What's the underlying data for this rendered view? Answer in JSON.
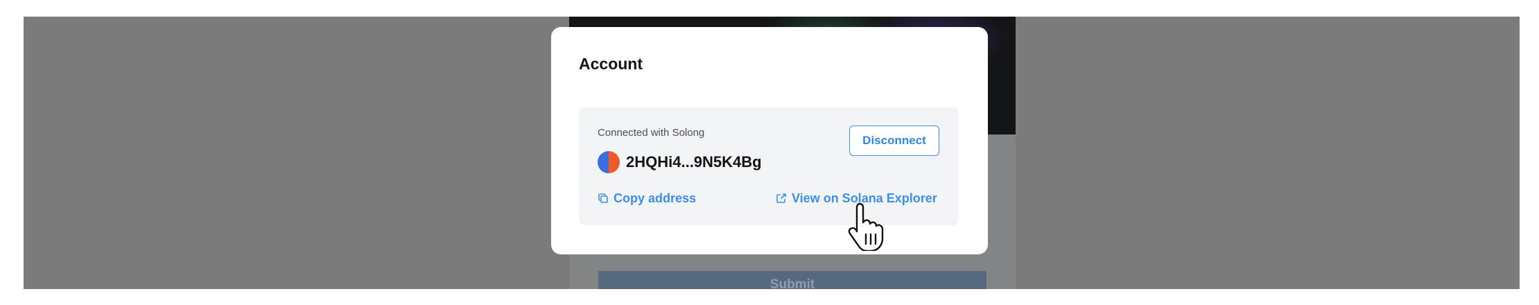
{
  "background_app": {
    "submit_label": "Submit"
  },
  "account_modal": {
    "title": "Account",
    "connected_label": "Connected with Solong",
    "address": "2HQHi4...9N5K4Bg",
    "disconnect_label": "Disconnect",
    "copy_address_label": "Copy address",
    "explorer_label": "View on Solana Explorer",
    "avatar_colors": [
      "#3c6ee0",
      "#ef5a2a"
    ],
    "accent_color": "#3d8fe6"
  },
  "icons": {
    "copy": "copy-icon",
    "external_link": "external-link-icon",
    "cursor": "hand-pointer-cursor-icon"
  }
}
